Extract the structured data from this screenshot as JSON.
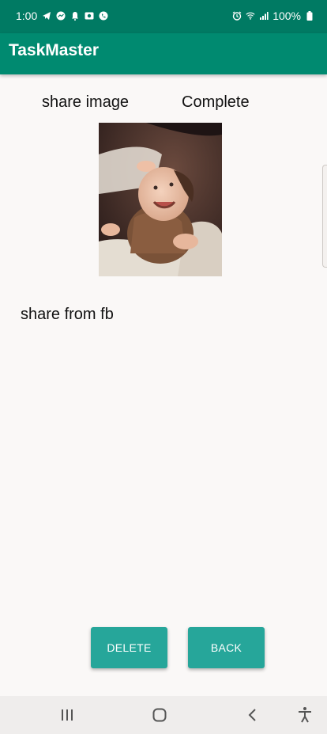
{
  "status_bar": {
    "time": "1:00",
    "battery": "100%",
    "icons_left": [
      "telegram-icon",
      "messenger-icon",
      "notification-bell-icon",
      "photo-icon",
      "phone-icon"
    ],
    "icons_right": [
      "alarm-icon",
      "wifi-icon",
      "signal-icon",
      "battery-icon"
    ]
  },
  "app_bar": {
    "title": "TaskMaster"
  },
  "task": {
    "title": "share image",
    "state": "Complete",
    "body": "share from fb",
    "image_icon": "baby-photo"
  },
  "buttons": {
    "delete": "DELETE",
    "back": "BACK"
  },
  "nav_bar": {
    "icons": [
      "recent-apps-icon",
      "home-icon",
      "back-icon",
      "accessibility-icon"
    ]
  },
  "colors": {
    "status_bar": "#007a63",
    "app_bar": "#008a70",
    "button": "#26a69a",
    "background": "#faf8f7"
  }
}
